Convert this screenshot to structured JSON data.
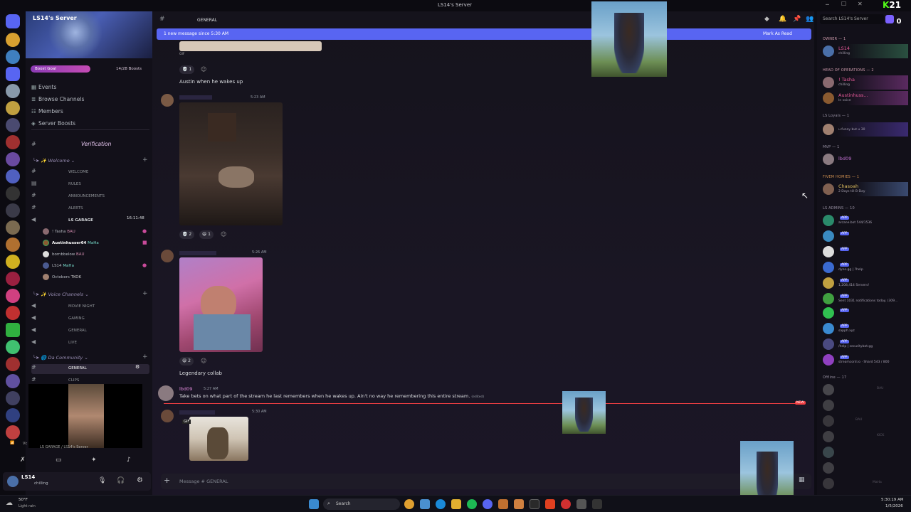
{
  "titlebar": {
    "title": "LS14's Server"
  },
  "server": {
    "name": "LS14's Server",
    "boost": {
      "label": "Boost Goal",
      "count": "14/28 Boosts",
      "progress": 0.5
    },
    "nav": [
      {
        "label": "Events",
        "icon": "calendar-icon"
      },
      {
        "label": "Browse Channels",
        "icon": "browse-icon"
      },
      {
        "label": "Members",
        "icon": "members-icon"
      },
      {
        "label": "Server Boosts",
        "icon": "boost-icon"
      }
    ],
    "verification": "Verification",
    "welcome_category": "Welcome",
    "channels": [
      "WELCOME",
      "RULES",
      "ANNOUNCEMENTS",
      "ALERTS"
    ],
    "voice_garage": {
      "name": "LS GARAGE",
      "timer": "16:11:48"
    },
    "voice_users": [
      {
        "name": "! Tasha",
        "tag": "BAU"
      },
      {
        "name": "Austinhusser64",
        "tag": "MaHa"
      },
      {
        "name": "bornbbelow",
        "tag": "BAU"
      },
      {
        "name": "LS14",
        "tag": "MaHa"
      },
      {
        "name": "Octobers",
        "tag": "TKOK"
      }
    ],
    "voice_category": "Voice Channels",
    "voice_channels": [
      "MOVIE NIGHT",
      "GAMING",
      "GENERAL",
      "LIVE"
    ],
    "community_category": "Da Community",
    "community_channels": [
      "GENERAL",
      "CLIPS"
    ],
    "stream_label": "LS GARAGE / LS14's Server",
    "user": {
      "name": "LS14",
      "status": "chilling"
    }
  },
  "chat": {
    "channel": "GENERAL",
    "new_banner": "1 new message since 5:30 AM",
    "mark_read": "Mark As Read",
    "gif_label": "GIF",
    "messages": [
      {
        "time": "",
        "text": "Austin when he wakes up",
        "reactions": [
          "1"
        ]
      },
      {
        "time": "5:23 AM",
        "text": "",
        "reactions": [
          "2",
          "1"
        ]
      },
      {
        "time": "5:26 AM",
        "text": "Legendary collab",
        "reactions": [
          "2"
        ]
      },
      {
        "author": "lbd09",
        "time": "5:27 AM",
        "text": "Take bets on what part of the stream he last remembers when he wakes up. Ain't no way he remembering this entire stream.",
        "edited": "(edited)"
      },
      {
        "time": "5:30 AM",
        "text": "",
        "gif": "GIF"
      }
    ],
    "new_tag": "NEW",
    "composer_placeholder": "Message # GENERAL"
  },
  "members": {
    "search_placeholder": "Search LS14's Server",
    "groups": [
      {
        "label": "OWNER — 1",
        "members": [
          {
            "name": "LS14",
            "status": "chilling",
            "tag": "MaHa"
          }
        ]
      },
      {
        "label": "HEAD OF OPERATIONS — 2",
        "members": [
          {
            "name": "! Tasha",
            "status": "chilling",
            "tag": "BAU"
          },
          {
            "name": "Austinhuss...",
            "status": "In voice",
            "tag": "MaHa"
          }
        ]
      },
      {
        "label": "LS Loyals — 1",
        "members": [
          {
            "name": "",
            "status": "u funny but u 30",
            "tag": "TKOK"
          }
        ]
      },
      {
        "label": "MVP — 1",
        "members": [
          {
            "name": "lbd09",
            "status": "",
            "tag": ""
          }
        ]
      },
      {
        "label": "FIVEM HOMIES — 1",
        "members": [
          {
            "name": "Chasoah",
            "status": "2 Days till B-Day",
            "tag": "osse"
          }
        ]
      }
    ],
    "admins_label": "LS ADMINS — 10",
    "admins": [
      {
        "status": "arcane.bot 544/1536"
      },
      {
        "status": ""
      },
      {
        "status": ""
      },
      {
        "status": "dyno.gg | ?help"
      },
      {
        "status": "1,208,414 Servers!"
      },
      {
        "status": "Sent 1031 notifications today. (309..."
      },
      {
        "status": ""
      },
      {
        "status": "sapph.xyz"
      },
      {
        "status": "/help | securitybot.gg"
      },
      {
        "status": "streamcord.io · Shard 543 / 800"
      }
    ],
    "app_tag": "APP",
    "offline_label": "Offline — 17",
    "offline_tags": [
      "BAU",
      "",
      "BAU",
      "KICK",
      "",
      "",
      "",
      "MaHa"
    ]
  },
  "taskbar": {
    "weather_temp": "50°F",
    "weather_text": "Light rain",
    "search": "Search",
    "time": "5:30:19 AM",
    "date": "1/5/2026"
  },
  "overlay": {
    "corner_number": "21",
    "badge_count": "0"
  }
}
